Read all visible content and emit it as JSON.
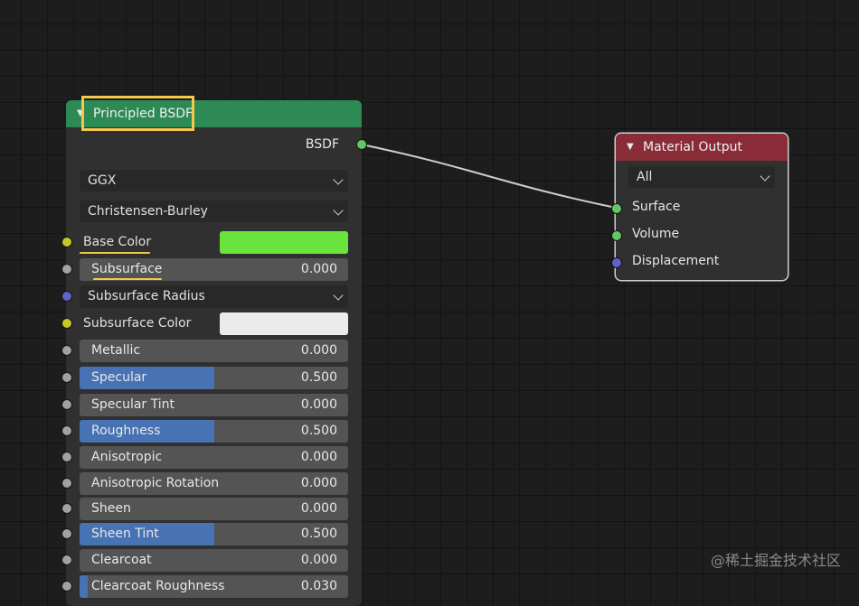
{
  "bsdf_node": {
    "title": "Principled BSDF",
    "output_label": "BSDF",
    "distribution": "GGX",
    "subsurface_method": "Christensen-Burley",
    "base_color": {
      "label": "Base Color",
      "value": "#6ae43d"
    },
    "subsurface": {
      "label": "Subsurface",
      "value": "0.000"
    },
    "subsurface_radius": "Subsurface Radius",
    "subsurface_color": {
      "label": "Subsurface Color",
      "value": "#ebebeb"
    },
    "sliders": [
      {
        "label": "Metallic",
        "value": "0.000",
        "fill": 0.0
      },
      {
        "label": "Specular",
        "value": "0.500",
        "fill": 0.5
      },
      {
        "label": "Specular Tint",
        "value": "0.000",
        "fill": 0.0
      },
      {
        "label": "Roughness",
        "value": "0.500",
        "fill": 0.5
      },
      {
        "label": "Anisotropic",
        "value": "0.000",
        "fill": 0.0
      },
      {
        "label": "Anisotropic Rotation",
        "value": "0.000",
        "fill": 0.0
      },
      {
        "label": "Sheen",
        "value": "0.000",
        "fill": 0.0
      },
      {
        "label": "Sheen Tint",
        "value": "0.500",
        "fill": 0.5
      },
      {
        "label": "Clearcoat",
        "value": "0.000",
        "fill": 0.0
      },
      {
        "label": "Clearcoat Roughness",
        "value": "0.030",
        "fill": 0.03
      }
    ]
  },
  "output_node": {
    "title": "Material Output",
    "target": "All",
    "inputs": [
      "Surface",
      "Volume",
      "Displacement"
    ]
  },
  "watermark": "@稀土掘金技术社区",
  "colors": {
    "bsdf_header": "#2e8a55",
    "output_header": "#8a2c38",
    "highlight": "#f4c84a",
    "slider_fill": "#4772b3"
  }
}
